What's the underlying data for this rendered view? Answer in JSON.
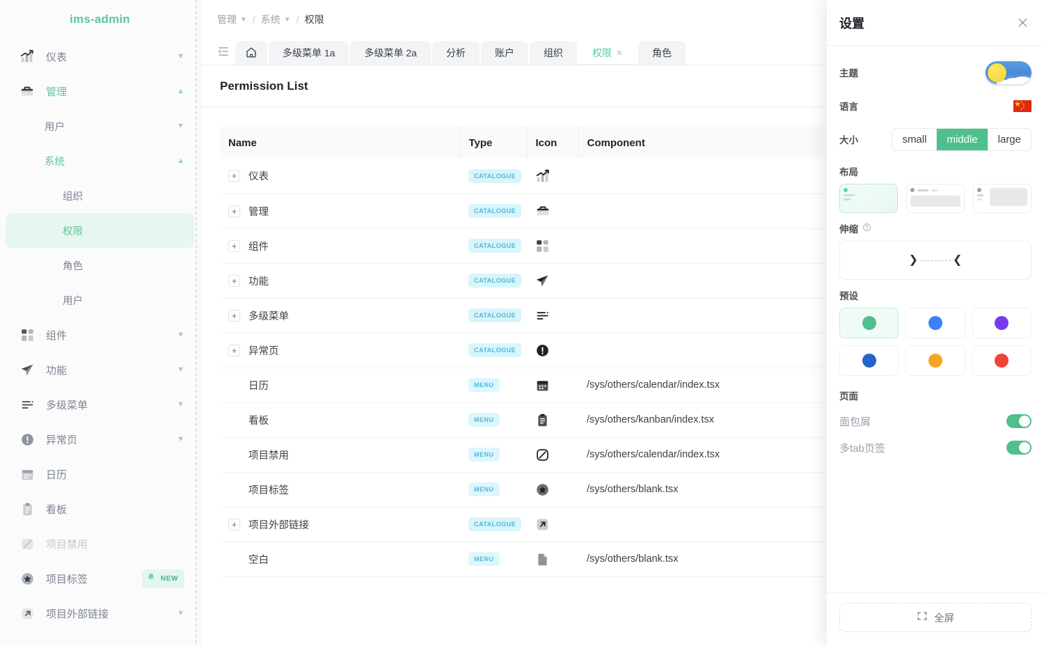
{
  "sidebar": {
    "brand": "ims-admin",
    "items": [
      {
        "label": "仪表",
        "icon": "chart-icon",
        "chevron": "down",
        "state": "normal"
      },
      {
        "label": "管理",
        "icon": "briefcase-icon",
        "chevron": "up",
        "state": "active"
      },
      {
        "label": "用户",
        "icon": "",
        "chevron": "down",
        "state": "sub"
      },
      {
        "label": "系统",
        "icon": "",
        "chevron": "up",
        "state": "sub-active"
      },
      {
        "label": "组织",
        "icon": "",
        "chevron": "",
        "state": "sub2"
      },
      {
        "label": "权限",
        "icon": "",
        "chevron": "",
        "state": "sub2-selected"
      },
      {
        "label": "角色",
        "icon": "",
        "chevron": "",
        "state": "sub2"
      },
      {
        "label": "用户",
        "icon": "",
        "chevron": "",
        "state": "sub2"
      },
      {
        "label": "组件",
        "icon": "grid-icon",
        "chevron": "down",
        "state": "normal"
      },
      {
        "label": "功能",
        "icon": "paper-plane-icon",
        "chevron": "down",
        "state": "normal"
      },
      {
        "label": "多级菜单",
        "icon": "menu-lines-icon",
        "chevron": "down",
        "state": "normal"
      },
      {
        "label": "异常页",
        "icon": "exclamation-icon",
        "chevron": "down",
        "state": "normal"
      },
      {
        "label": "日历",
        "icon": "calendar-icon",
        "chevron": "",
        "state": "normal"
      },
      {
        "label": "看板",
        "icon": "clipboard-icon",
        "chevron": "",
        "state": "normal"
      },
      {
        "label": "项目禁用",
        "icon": "disabled-icon",
        "chevron": "",
        "state": "muted"
      },
      {
        "label": "项目标签",
        "icon": "star-icon",
        "chevron": "",
        "state": "normal",
        "badge": "NEW",
        "badge_icon": "bell-icon"
      },
      {
        "label": "项目外部链接",
        "icon": "external-link-icon",
        "chevron": "down",
        "state": "normal"
      }
    ]
  },
  "breadcrumb": {
    "items": [
      "管理",
      "系统",
      "权限"
    ],
    "separator": "/"
  },
  "tabs": {
    "toggle_icon": "collapse-tabs-icon",
    "home_icon": "home-icon",
    "items": [
      {
        "label": "多级菜单 1a",
        "active": false,
        "closable": false
      },
      {
        "label": "多级菜单 2a",
        "active": false,
        "closable": false
      },
      {
        "label": "分析",
        "active": false,
        "closable": false
      },
      {
        "label": "账户",
        "active": false,
        "closable": false
      },
      {
        "label": "组织",
        "active": false,
        "closable": false
      },
      {
        "label": "权限",
        "active": true,
        "closable": true
      },
      {
        "label": "角色",
        "active": false,
        "closable": false
      }
    ]
  },
  "page": {
    "title": "Permission List"
  },
  "table": {
    "columns": [
      "Name",
      "Type",
      "Icon",
      "Component"
    ],
    "rows": [
      {
        "name": "仪表",
        "expandable": true,
        "type": "CATALOGUE",
        "icon": "chart-icon",
        "component": ""
      },
      {
        "name": "管理",
        "expandable": true,
        "type": "CATALOGUE",
        "icon": "briefcase-icon",
        "component": ""
      },
      {
        "name": "组件",
        "expandable": true,
        "type": "CATALOGUE",
        "icon": "grid-icon",
        "component": ""
      },
      {
        "name": "功能",
        "expandable": true,
        "type": "CATALOGUE",
        "icon": "paper-plane-icon",
        "component": ""
      },
      {
        "name": "多级菜单",
        "expandable": true,
        "type": "CATALOGUE",
        "icon": "menu-lines-icon",
        "component": ""
      },
      {
        "name": "异常页",
        "expandable": true,
        "type": "CATALOGUE",
        "icon": "exclamation-icon",
        "component": ""
      },
      {
        "name": "日历",
        "expandable": false,
        "type": "MENU",
        "icon": "calendar-icon",
        "component": "/sys/others/calendar/index.tsx"
      },
      {
        "name": "看板",
        "expandable": false,
        "type": "MENU",
        "icon": "clipboard-icon",
        "component": "/sys/others/kanban/index.tsx"
      },
      {
        "name": "项目禁用",
        "expandable": false,
        "type": "MENU",
        "icon": "disabled-icon",
        "component": "/sys/others/calendar/index.tsx"
      },
      {
        "name": "项目标签",
        "expandable": false,
        "type": "MENU",
        "icon": "star-icon",
        "component": "/sys/others/blank.tsx"
      },
      {
        "name": "项目外部链接",
        "expandable": true,
        "type": "CATALOGUE",
        "icon": "external-link-icon",
        "component": ""
      },
      {
        "name": "空白",
        "expandable": false,
        "type": "MENU",
        "icon": "file-icon",
        "component": "/sys/others/blank.tsx"
      }
    ]
  },
  "settings": {
    "title": "设置",
    "close_icon": "close-icon",
    "theme": {
      "label": "主题",
      "value": "light"
    },
    "language": {
      "label": "语言",
      "value": "zh-CN",
      "flag": "cn-flag-icon"
    },
    "size": {
      "label": "大小",
      "options": [
        "small",
        "middle",
        "large"
      ],
      "selected": "middle"
    },
    "layout": {
      "label": "布局",
      "options": [
        "vertical",
        "horizontal",
        "mixed"
      ],
      "selected": "vertical"
    },
    "stretch": {
      "label": "伸缩",
      "help_icon": "question-icon"
    },
    "presets": {
      "label": "预设",
      "colors": [
        "#4fc08d",
        "#3b82f6",
        "#7c3aed",
        "#2563c9",
        "#f5a623",
        "#f04438"
      ],
      "selected_index": 0
    },
    "pageSection": {
      "label": "页面",
      "items": [
        {
          "label": "面包屑",
          "on": true
        },
        {
          "label": "多tab页签",
          "on": true
        }
      ]
    },
    "fullscreen": {
      "label": "全屏",
      "icon": "fullscreen-icon"
    }
  },
  "colors": {
    "accent": "#4fc08d",
    "accent_light": "#e6f7ef",
    "badge_catalogue_bg": "#d8f5fb",
    "badge_catalogue_fg": "#4fb8d8",
    "badge_menu_bg": "#ddf6fd",
    "badge_menu_fg": "#56b8d9"
  }
}
